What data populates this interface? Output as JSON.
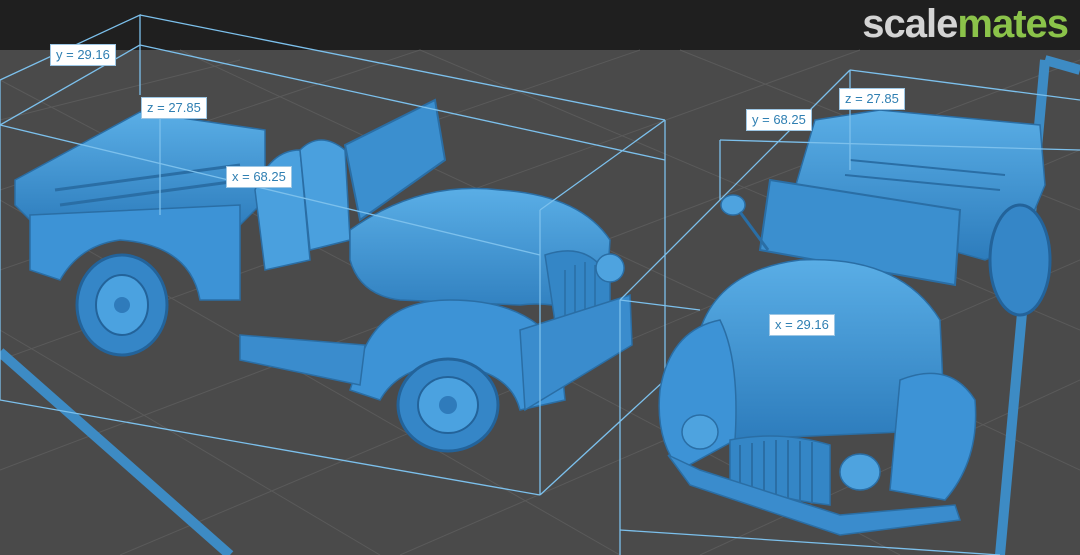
{
  "watermark": {
    "part1": "scale",
    "part2": "mates"
  },
  "colors": {
    "background": "#4a4a4a",
    "top_bar": "#1f1f1f",
    "model": "#3a8fd0",
    "bounding_box": "#7cc0ec",
    "label_text": "#2f7fb2"
  },
  "left_model": {
    "labels": {
      "y": "y = 29.16",
      "z": "z = 27.85",
      "x": "x = 68.25"
    }
  },
  "right_model": {
    "labels": {
      "y": "y = 68.25",
      "z": "z = 27.85",
      "x": "x = 29.16"
    }
  }
}
